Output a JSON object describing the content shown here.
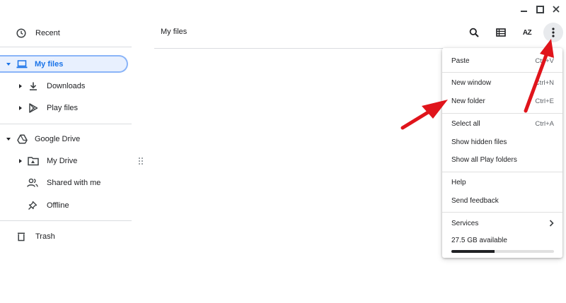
{
  "window_controls": {
    "minimize": "–",
    "maximize": "☐",
    "close": "✕"
  },
  "sidebar": {
    "recent": "Recent",
    "my_files": "My files",
    "downloads": "Downloads",
    "play_files": "Play files",
    "google_drive": "Google Drive",
    "my_drive": "My Drive",
    "shared_with_me": "Shared with me",
    "offline": "Offline",
    "trash": "Trash"
  },
  "header": {
    "title": "My files",
    "sort_label": "AZ"
  },
  "menu": {
    "paste": {
      "label": "Paste",
      "shortcut": "Ctrl+V"
    },
    "new_window": {
      "label": "New window",
      "shortcut": "Ctrl+N"
    },
    "new_folder": {
      "label": "New folder",
      "shortcut": "Ctrl+E"
    },
    "select_all": {
      "label": "Select all",
      "shortcut": "Ctrl+A"
    },
    "show_hidden": {
      "label": "Show hidden files"
    },
    "show_play": {
      "label": "Show all Play folders"
    },
    "help": {
      "label": "Help"
    },
    "feedback": {
      "label": "Send feedback"
    },
    "services": {
      "label": "Services"
    },
    "storage": {
      "label": "27.5 GB available",
      "used_fraction": 0.42
    }
  },
  "colors": {
    "accent": "#1a73e8",
    "selected_bg": "#e8f0fe",
    "arrow": "#e0141b"
  }
}
